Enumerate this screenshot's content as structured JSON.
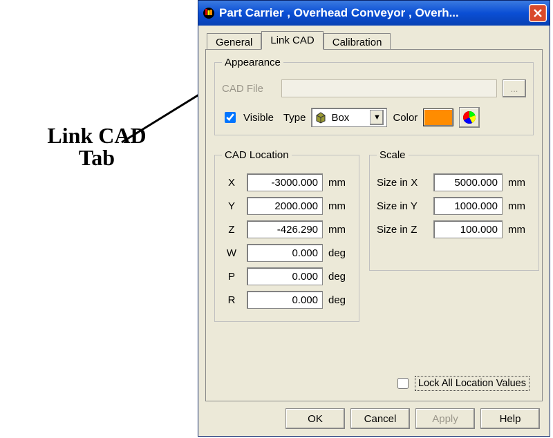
{
  "annotation": {
    "text1": "Link CAD",
    "text2": "Tab"
  },
  "titlebar": {
    "title": "Part Carrier , Overhead Conveyor , Overh..."
  },
  "tabs": {
    "general": "General",
    "link_cad": "Link CAD",
    "calibration": "Calibration"
  },
  "appearance": {
    "legend": "Appearance",
    "cadfile_label": "CAD File",
    "cadfile_value": "",
    "browse_label": "...",
    "visible_label": "Visible",
    "visible_checked": true,
    "type_label": "Type",
    "type_value": "Box",
    "color_label": "Color",
    "color_value": "#ff8c00"
  },
  "cad_location": {
    "legend": "CAD Location",
    "rows": [
      {
        "label": "X",
        "value": "-3000.000",
        "unit": "mm"
      },
      {
        "label": "Y",
        "value": "2000.000",
        "unit": "mm"
      },
      {
        "label": "Z",
        "value": "-426.290",
        "unit": "mm"
      },
      {
        "label": "W",
        "value": "0.000",
        "unit": "deg"
      },
      {
        "label": "P",
        "value": "0.000",
        "unit": "deg"
      },
      {
        "label": "R",
        "value": "0.000",
        "unit": "deg"
      }
    ]
  },
  "scale": {
    "legend": "Scale",
    "rows": [
      {
        "label": "Size in X",
        "value": "5000.000",
        "unit": "mm"
      },
      {
        "label": "Size in Y",
        "value": "1000.000",
        "unit": "mm"
      },
      {
        "label": "Size in Z",
        "value": "100.000",
        "unit": "mm"
      }
    ]
  },
  "lock": {
    "checked": false,
    "label": "Lock All Location Values"
  },
  "buttons": {
    "ok": "OK",
    "cancel": "Cancel",
    "apply": "Apply",
    "help": "Help"
  }
}
